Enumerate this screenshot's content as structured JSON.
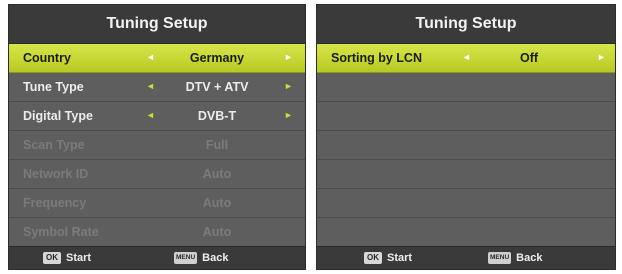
{
  "left": {
    "title": "Tuning Setup",
    "rows": [
      {
        "label": "Country",
        "value": "Germany",
        "state": "selected"
      },
      {
        "label": "Tune Type",
        "value": "DTV + ATV",
        "state": "normal"
      },
      {
        "label": "Digital Type",
        "value": "DVB-T",
        "state": "normal"
      },
      {
        "label": "Scan Type",
        "value": "Full",
        "state": "disabled"
      },
      {
        "label": "Network ID",
        "value": "Auto",
        "state": "disabled"
      },
      {
        "label": "Frequency",
        "value": "Auto",
        "state": "disabled"
      },
      {
        "label": "Symbol Rate",
        "value": "Auto",
        "state": "disabled"
      }
    ],
    "footer": {
      "ok_key": "OK",
      "ok_label": "Start",
      "menu_key": "MENU",
      "menu_label": "Back"
    }
  },
  "right": {
    "title": "Tuning Setup",
    "rows": [
      {
        "label": "Sorting by LCN",
        "value": "Off",
        "state": "selected"
      }
    ],
    "empty_rows": 6,
    "footer": {
      "ok_key": "OK",
      "ok_label": "Start",
      "menu_key": "MENU",
      "menu_label": "Back"
    }
  },
  "arrows": {
    "left": "◄",
    "right": "►"
  },
  "colors": {
    "highlight": "#c6d932",
    "arrow": "#c8df34",
    "panel": "#5e5e5e",
    "disabled_text": "#7b7b7b"
  }
}
